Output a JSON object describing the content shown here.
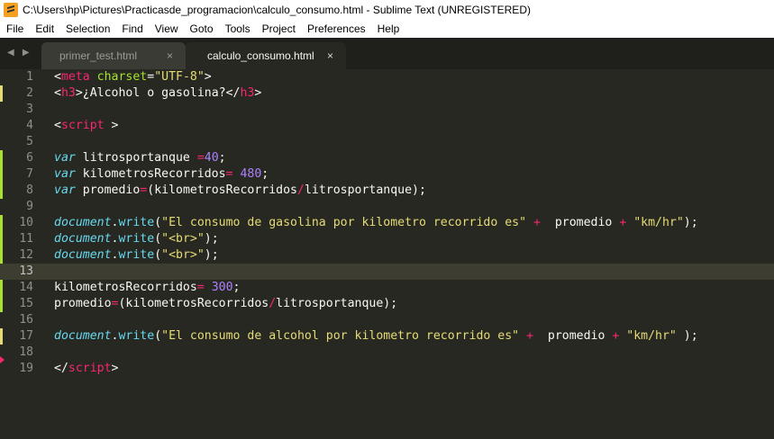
{
  "window": {
    "title": "C:\\Users\\hp\\Pictures\\Practicasde_programacion\\calculo_consumo.html - Sublime Text (UNREGISTERED)",
    "app_icon": "sublime-text-icon"
  },
  "menu": [
    "File",
    "Edit",
    "Selection",
    "Find",
    "View",
    "Goto",
    "Tools",
    "Project",
    "Preferences",
    "Help"
  ],
  "tab_nav": "◀ ▶",
  "tabs": [
    {
      "label": "primer_test.html",
      "close": "×",
      "active": false
    },
    {
      "label": "calculo_consumo.html",
      "close": "×",
      "active": true
    }
  ],
  "editor": {
    "current_line": 13,
    "lines": [
      {
        "n": "1",
        "marker": "",
        "tokens": [
          [
            "t-plain",
            "<"
          ],
          [
            "t-tag",
            "meta"
          ],
          [
            "t-plain",
            " "
          ],
          [
            "t-attr",
            "charset"
          ],
          [
            "t-plain",
            "="
          ],
          [
            "t-str",
            "\"UTF-8\""
          ],
          [
            "t-plain",
            ">"
          ]
        ]
      },
      {
        "n": "2",
        "marker": "mod",
        "tokens": [
          [
            "t-plain",
            "<"
          ],
          [
            "t-tag",
            "h3"
          ],
          [
            "t-plain",
            ">¿Alcohol o gasolina?</"
          ],
          [
            "t-tag",
            "h3"
          ],
          [
            "t-plain",
            ">"
          ]
        ]
      },
      {
        "n": "3",
        "marker": "",
        "tokens": []
      },
      {
        "n": "4",
        "marker": "",
        "tokens": [
          [
            "t-plain",
            "<"
          ],
          [
            "t-tag",
            "script"
          ],
          [
            "t-plain",
            " >"
          ]
        ]
      },
      {
        "n": "5",
        "marker": "",
        "tokens": []
      },
      {
        "n": "6",
        "marker": "add",
        "tokens": [
          [
            "t-kw",
            "var"
          ],
          [
            "t-plain",
            " litrosportanque "
          ],
          [
            "t-op",
            "="
          ],
          [
            "t-num",
            "40"
          ],
          [
            "t-plain",
            ";"
          ]
        ]
      },
      {
        "n": "7",
        "marker": "add",
        "tokens": [
          [
            "t-kw",
            "var"
          ],
          [
            "t-plain",
            " kilometrosRecorridos"
          ],
          [
            "t-op",
            "="
          ],
          [
            "t-plain",
            " "
          ],
          [
            "t-num",
            "480"
          ],
          [
            "t-plain",
            ";"
          ]
        ]
      },
      {
        "n": "8",
        "marker": "add",
        "tokens": [
          [
            "t-kw",
            "var"
          ],
          [
            "t-plain",
            " promedio"
          ],
          [
            "t-op",
            "="
          ],
          [
            "t-plain",
            "(kilometrosRecorridos"
          ],
          [
            "t-op",
            "/"
          ],
          [
            "t-plain",
            "litrosportanque);"
          ]
        ]
      },
      {
        "n": "9",
        "marker": "",
        "tokens": []
      },
      {
        "n": "10",
        "marker": "add",
        "tokens": [
          [
            "t-kw",
            "document"
          ],
          [
            "t-plain",
            "."
          ],
          [
            "t-fn",
            "write"
          ],
          [
            "t-plain",
            "("
          ],
          [
            "t-str",
            "\"El consumo de gasolina por kilometro recorrido es\""
          ],
          [
            "t-plain",
            " "
          ],
          [
            "t-op",
            "+"
          ],
          [
            "t-plain",
            "  promedio "
          ],
          [
            "t-op",
            "+"
          ],
          [
            "t-plain",
            " "
          ],
          [
            "t-str",
            "\"km/hr\""
          ],
          [
            "t-plain",
            ");"
          ]
        ]
      },
      {
        "n": "11",
        "marker": "add",
        "tokens": [
          [
            "t-kw",
            "document"
          ],
          [
            "t-plain",
            "."
          ],
          [
            "t-fn",
            "write"
          ],
          [
            "t-plain",
            "("
          ],
          [
            "t-str",
            "\"<br>\""
          ],
          [
            "t-plain",
            ");"
          ]
        ]
      },
      {
        "n": "12",
        "marker": "add",
        "tokens": [
          [
            "t-kw",
            "document"
          ],
          [
            "t-plain",
            "."
          ],
          [
            "t-fn",
            "write"
          ],
          [
            "t-plain",
            "("
          ],
          [
            "t-str",
            "\"<br>\""
          ],
          [
            "t-plain",
            ");"
          ]
        ]
      },
      {
        "n": "13",
        "marker": "",
        "tokens": []
      },
      {
        "n": "14",
        "marker": "add",
        "tokens": [
          [
            "t-plain",
            "kilometrosRecorridos"
          ],
          [
            "t-op",
            "="
          ],
          [
            "t-plain",
            " "
          ],
          [
            "t-num",
            "300"
          ],
          [
            "t-plain",
            ";"
          ]
        ]
      },
      {
        "n": "15",
        "marker": "add",
        "tokens": [
          [
            "t-plain",
            "promedio"
          ],
          [
            "t-op",
            "="
          ],
          [
            "t-plain",
            "(kilometrosRecorridos"
          ],
          [
            "t-op",
            "/"
          ],
          [
            "t-plain",
            "litrosportanque);"
          ]
        ]
      },
      {
        "n": "16",
        "marker": "",
        "tokens": []
      },
      {
        "n": "17",
        "marker": "mod",
        "tokens": [
          [
            "t-kw",
            "document"
          ],
          [
            "t-plain",
            "."
          ],
          [
            "t-fn",
            "write"
          ],
          [
            "t-plain",
            "("
          ],
          [
            "t-str",
            "\"El consumo de alcohol por kilometro recorrido es\""
          ],
          [
            "t-plain",
            " "
          ],
          [
            "t-op",
            "+"
          ],
          [
            "t-plain",
            "  promedio "
          ],
          [
            "t-op",
            "+"
          ],
          [
            "t-plain",
            " "
          ],
          [
            "t-str",
            "\"km/hr\""
          ],
          [
            "t-plain",
            " );"
          ]
        ]
      },
      {
        "n": "18",
        "marker": "deleted",
        "tokens": []
      },
      {
        "n": "19",
        "marker": "",
        "tokens": [
          [
            "t-plain",
            "</"
          ],
          [
            "t-tag",
            "script"
          ],
          [
            "t-plain",
            ">"
          ]
        ]
      }
    ]
  }
}
